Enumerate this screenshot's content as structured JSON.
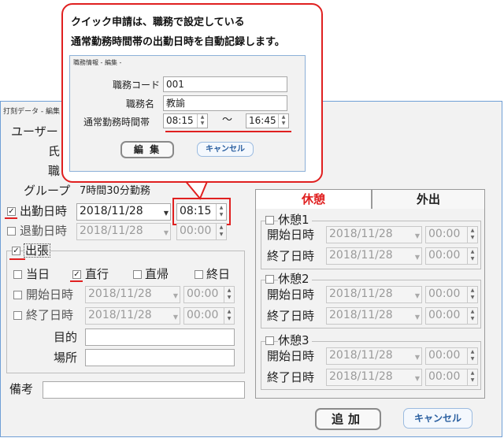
{
  "window": {
    "title": "打刻データ - 編集"
  },
  "fields": {
    "user_label": "ユーザー",
    "name_label": "氏",
    "job_label": "職",
    "group_label": "グループ",
    "group_value": "7時間30分勤務"
  },
  "attendance": {
    "checked": true,
    "label": "出勤日時",
    "date": "2018/11/28",
    "time": "08:15"
  },
  "leave": {
    "checked": false,
    "label": "退勤日時",
    "date": "2018/11/28",
    "time": "00:00"
  },
  "business_trip": {
    "checked": true,
    "label": "出張",
    "options": {
      "same_day": {
        "label": "当日",
        "checked": false
      },
      "direct_go": {
        "label": "直行",
        "checked": true
      },
      "direct_return": {
        "label": "直帰",
        "checked": false
      },
      "all_day": {
        "label": "終日",
        "checked": false
      }
    },
    "start_label": "開始日時",
    "start_date": "2018/11/28",
    "start_time": "00:00",
    "end_label": "終了日時",
    "end_date": "2018/11/28",
    "end_time": "00:00",
    "purpose_label": "目的",
    "place_label": "場所"
  },
  "remarks_label": "備考",
  "tabs": {
    "break": "休憩",
    "out": "外出"
  },
  "breaks": [
    {
      "label": "休憩1",
      "start_label": "開始日時",
      "start_date": "2018/11/28",
      "start_time": "00:00",
      "end_label": "終了日時",
      "end_date": "2018/11/28",
      "end_time": "00:00"
    },
    {
      "label": "休憩2",
      "start_label": "開始日時",
      "start_date": "2018/11/28",
      "start_time": "00:00",
      "end_label": "終了日時",
      "end_date": "2018/11/28",
      "end_time": "00:00"
    },
    {
      "label": "休憩3",
      "start_label": "開始日時",
      "start_date": "2018/11/28",
      "start_time": "00:00",
      "end_label": "終了日時",
      "end_date": "2018/11/28",
      "end_time": "00:00"
    }
  ],
  "buttons": {
    "add": "追加",
    "cancel": "キャンセル"
  },
  "callout": {
    "line1": "クイック申請は、職務で設定している",
    "line2": "通常勤務時間帯の出勤日時を自動記録します。",
    "dialog": {
      "title": "職務情報 - 編集 -",
      "code_label": "職務コード",
      "code_value": "001",
      "name_label": "職務名",
      "name_value": "教諭",
      "hours_label": "通常勤務時間帯",
      "start_time": "08:15",
      "tilde": "～",
      "end_time": "16:45",
      "edit_button": "編 集",
      "cancel_button": "キャンセル"
    }
  },
  "colors": {
    "accent_red": "#e02020",
    "tab_active": "#e02020",
    "window_border": "#6f9fd6"
  }
}
